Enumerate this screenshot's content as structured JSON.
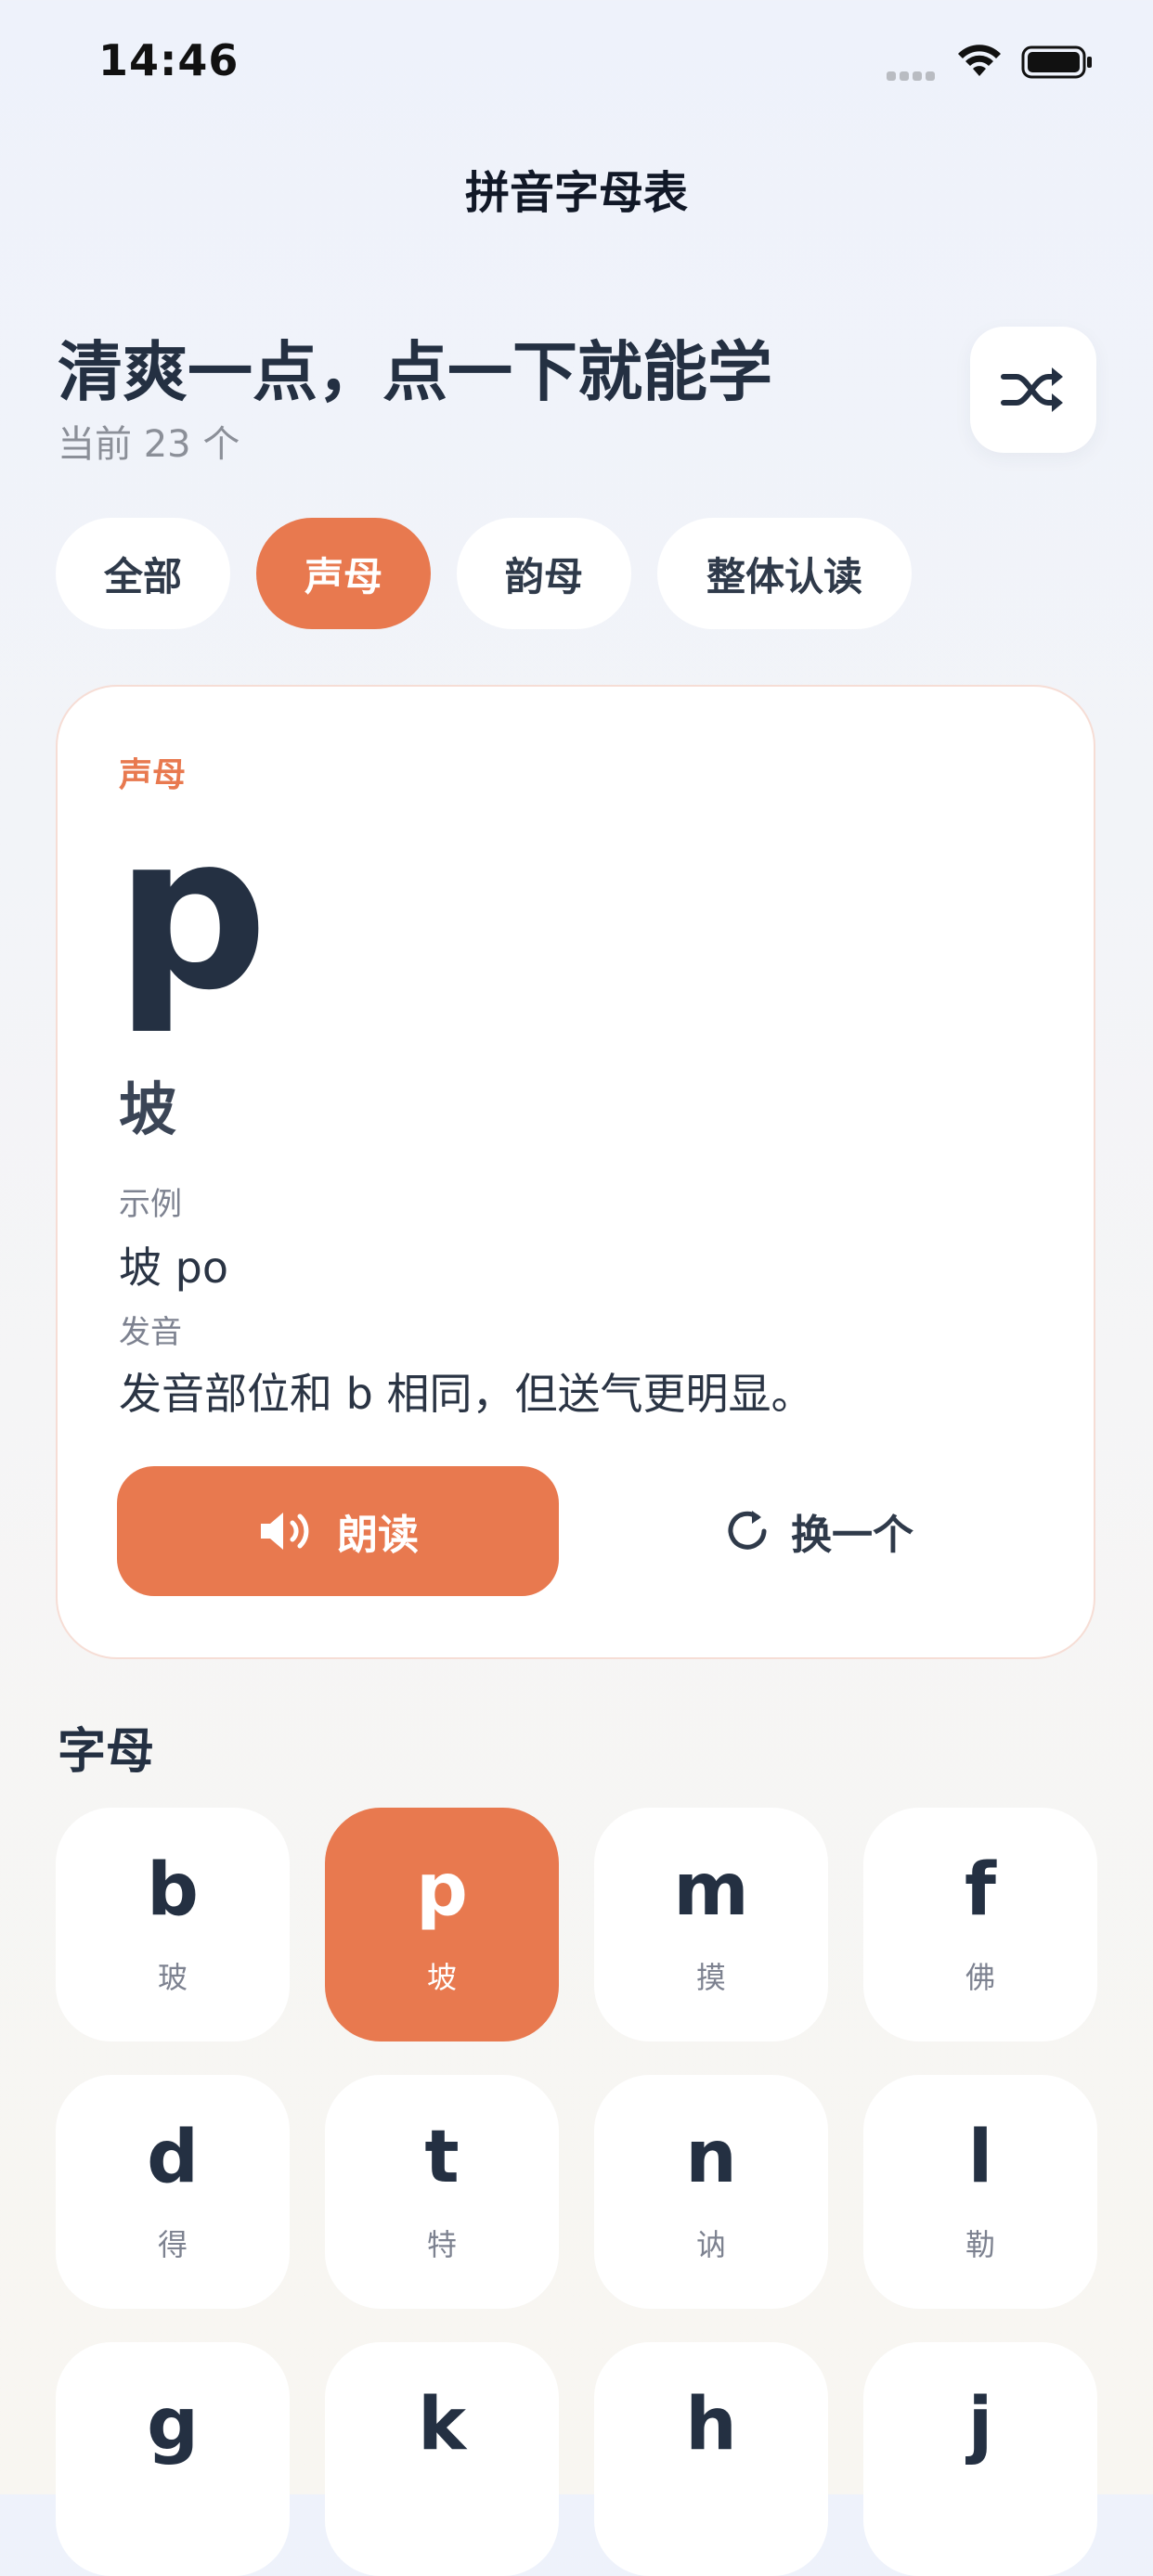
{
  "status_bar": {
    "time": "14:46"
  },
  "nav": {
    "title": "拼音字母表"
  },
  "hero": {
    "title": "清爽一点，点一下就能学",
    "count": "当前 23 个",
    "shuffle_icon": "shuffle-icon"
  },
  "tabs": [
    {
      "label": "全部",
      "active": false
    },
    {
      "label": "声母",
      "active": true
    },
    {
      "label": "韵母",
      "active": false
    },
    {
      "label": "整体认读",
      "active": false
    }
  ],
  "card": {
    "category": "声母",
    "letter": "p",
    "character": "坡",
    "example_label": "示例",
    "example_value": "坡 po",
    "pronunciation_label": "发音",
    "pronunciation_value": "发音部位和 b 相同，但送气更明显。",
    "read_label": "朗读",
    "read_icon": "speaker-icon",
    "change_label": "换一个",
    "change_icon": "refresh-icon"
  },
  "letters_section": {
    "title": "字母",
    "items": [
      {
        "letter": "b",
        "char": "玻",
        "active": false
      },
      {
        "letter": "p",
        "char": "坡",
        "active": true
      },
      {
        "letter": "m",
        "char": "摸",
        "active": false
      },
      {
        "letter": "f",
        "char": "佛",
        "active": false
      },
      {
        "letter": "d",
        "char": "得",
        "active": false
      },
      {
        "letter": "t",
        "char": "特",
        "active": false
      },
      {
        "letter": "n",
        "char": "讷",
        "active": false
      },
      {
        "letter": "l",
        "char": "勒",
        "active": false
      },
      {
        "letter": "g",
        "char": "",
        "active": false
      },
      {
        "letter": "k",
        "char": "",
        "active": false
      },
      {
        "letter": "h",
        "char": "",
        "active": false
      },
      {
        "letter": "j",
        "char": "",
        "active": false
      }
    ]
  },
  "colors": {
    "accent": "#e8794f",
    "text_dark": "#243042",
    "text_muted": "#7d8290"
  }
}
